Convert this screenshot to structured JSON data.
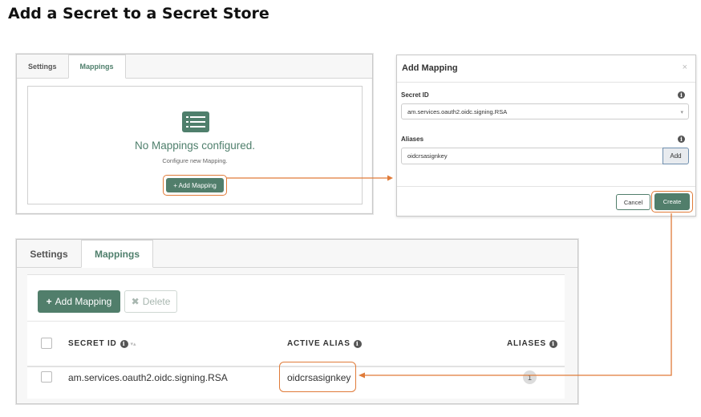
{
  "page": {
    "title": "Add a Secret to a Secret Store"
  },
  "panel1": {
    "tabs": [
      "Settings",
      "Mappings"
    ],
    "empty_message": "No Mappings configured.",
    "empty_hint": "Configure new Mapping.",
    "add_button": "+ Add Mapping"
  },
  "modal": {
    "title": "Add Mapping",
    "close": "×",
    "secret_id_label": "Secret ID",
    "secret_id_value": "am.services.oauth2.oidc.signing.RSA",
    "aliases_label": "Aliases",
    "alias_value": "oidcrsasignkey",
    "add_alias_button": "Add",
    "cancel_button": "Cancel",
    "create_button": "Create"
  },
  "panel2": {
    "tabs": [
      "Settings",
      "Mappings"
    ],
    "add_button": "Add Mapping",
    "delete_button": "Delete",
    "columns": {
      "secret_id": "SECRET ID",
      "active_alias": "ACTIVE ALIAS",
      "aliases": "ALIASES"
    },
    "rows": [
      {
        "secret_id": "am.services.oauth2.oidc.signing.RSA",
        "active_alias": "oidcrsasignkey",
        "aliases": "1"
      }
    ]
  },
  "colors": {
    "accent": "#517e6b",
    "callout": "#e07b39"
  },
  "icons": [
    "list-icon",
    "info-icon",
    "plus-icon",
    "times-icon",
    "sort-icon",
    "close-icon",
    "chevron-down-icon"
  ]
}
